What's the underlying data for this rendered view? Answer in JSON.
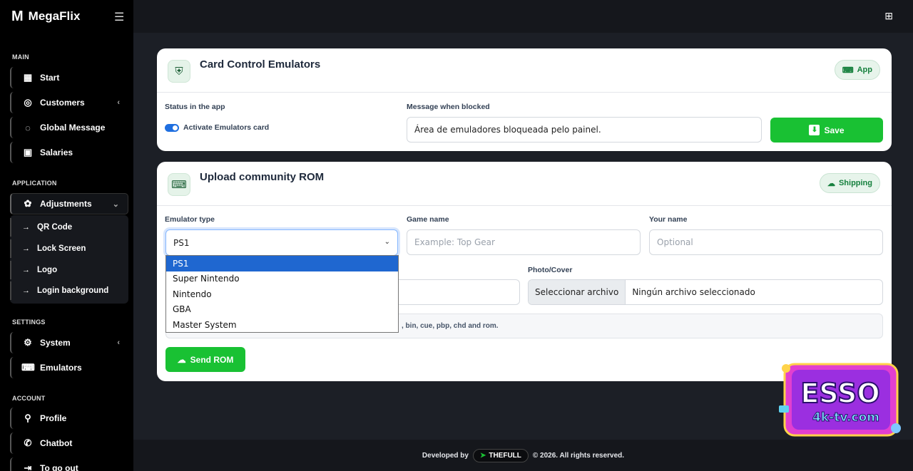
{
  "app": {
    "logo": "M",
    "name": "MegaFlix"
  },
  "sidebar": {
    "sections": {
      "main": "MAIN",
      "application": "APPLICATION",
      "settings": "SETTINGS",
      "account": "ACCOUNT"
    },
    "main_items": [
      {
        "label": "Start",
        "icon": "dashboard-icon"
      },
      {
        "label": "Customers",
        "icon": "user-circle-icon"
      },
      {
        "label": "Global Message",
        "icon": "chat-bubble-icon"
      },
      {
        "label": "Salaries",
        "icon": "calendar-icon"
      }
    ],
    "application_items": [
      {
        "label": "Adjustments",
        "icon": "palette-icon"
      }
    ],
    "adjustments_sub": [
      {
        "label": "QR Code"
      },
      {
        "label": "Lock Screen"
      },
      {
        "label": "Logo"
      },
      {
        "label": "Login background"
      }
    ],
    "settings_items": [
      {
        "label": "System",
        "icon": "gear-icon"
      },
      {
        "label": "Emulators",
        "icon": "gamepad-icon"
      }
    ],
    "account_items": [
      {
        "label": "Profile",
        "icon": "user-icon"
      },
      {
        "label": "Chatbot",
        "icon": "whatsapp-icon"
      },
      {
        "label": "To go out",
        "icon": "logout-icon"
      }
    ]
  },
  "card1": {
    "title": "Card Control Emulators",
    "badge": "App",
    "status_label": "Status in the app",
    "toggle_label": "Activate Emulators card",
    "toggle_on": true,
    "message_label": "Message when blocked",
    "message_value": "Área de emuladores bloqueada pelo painel.",
    "save_label": "Save"
  },
  "card2": {
    "title": "Upload community ROM",
    "badge": "Shipping",
    "emulator_label": "Emulator type",
    "emulator_value": "PS1",
    "emulator_options": [
      "PS1",
      "Super Nintendo",
      "Nintendo",
      "GBA",
      "Master System"
    ],
    "game_label": "Game name",
    "game_placeholder": "Example: Top Gear",
    "your_name_label": "Your name",
    "your_name_placeholder": "Optional",
    "photo_label": "Photo/Cover",
    "file_button": "Seleccionar archivo",
    "file_status": "Ningún archivo seleccionado",
    "note_text": ", bin, cue, pbp, chd and rom.",
    "send_label": "Send ROM"
  },
  "footer": {
    "developed": "Developed by",
    "brand": "THEFULL",
    "rights": "© 2026. All rights reserved."
  },
  "watermark": {
    "brand": "ESSO",
    "site": "4k-tv.com"
  },
  "colors": {
    "accent_green": "#19c133",
    "toggle_blue": "#1f6fe0",
    "select_highlight": "#1f67d0"
  }
}
